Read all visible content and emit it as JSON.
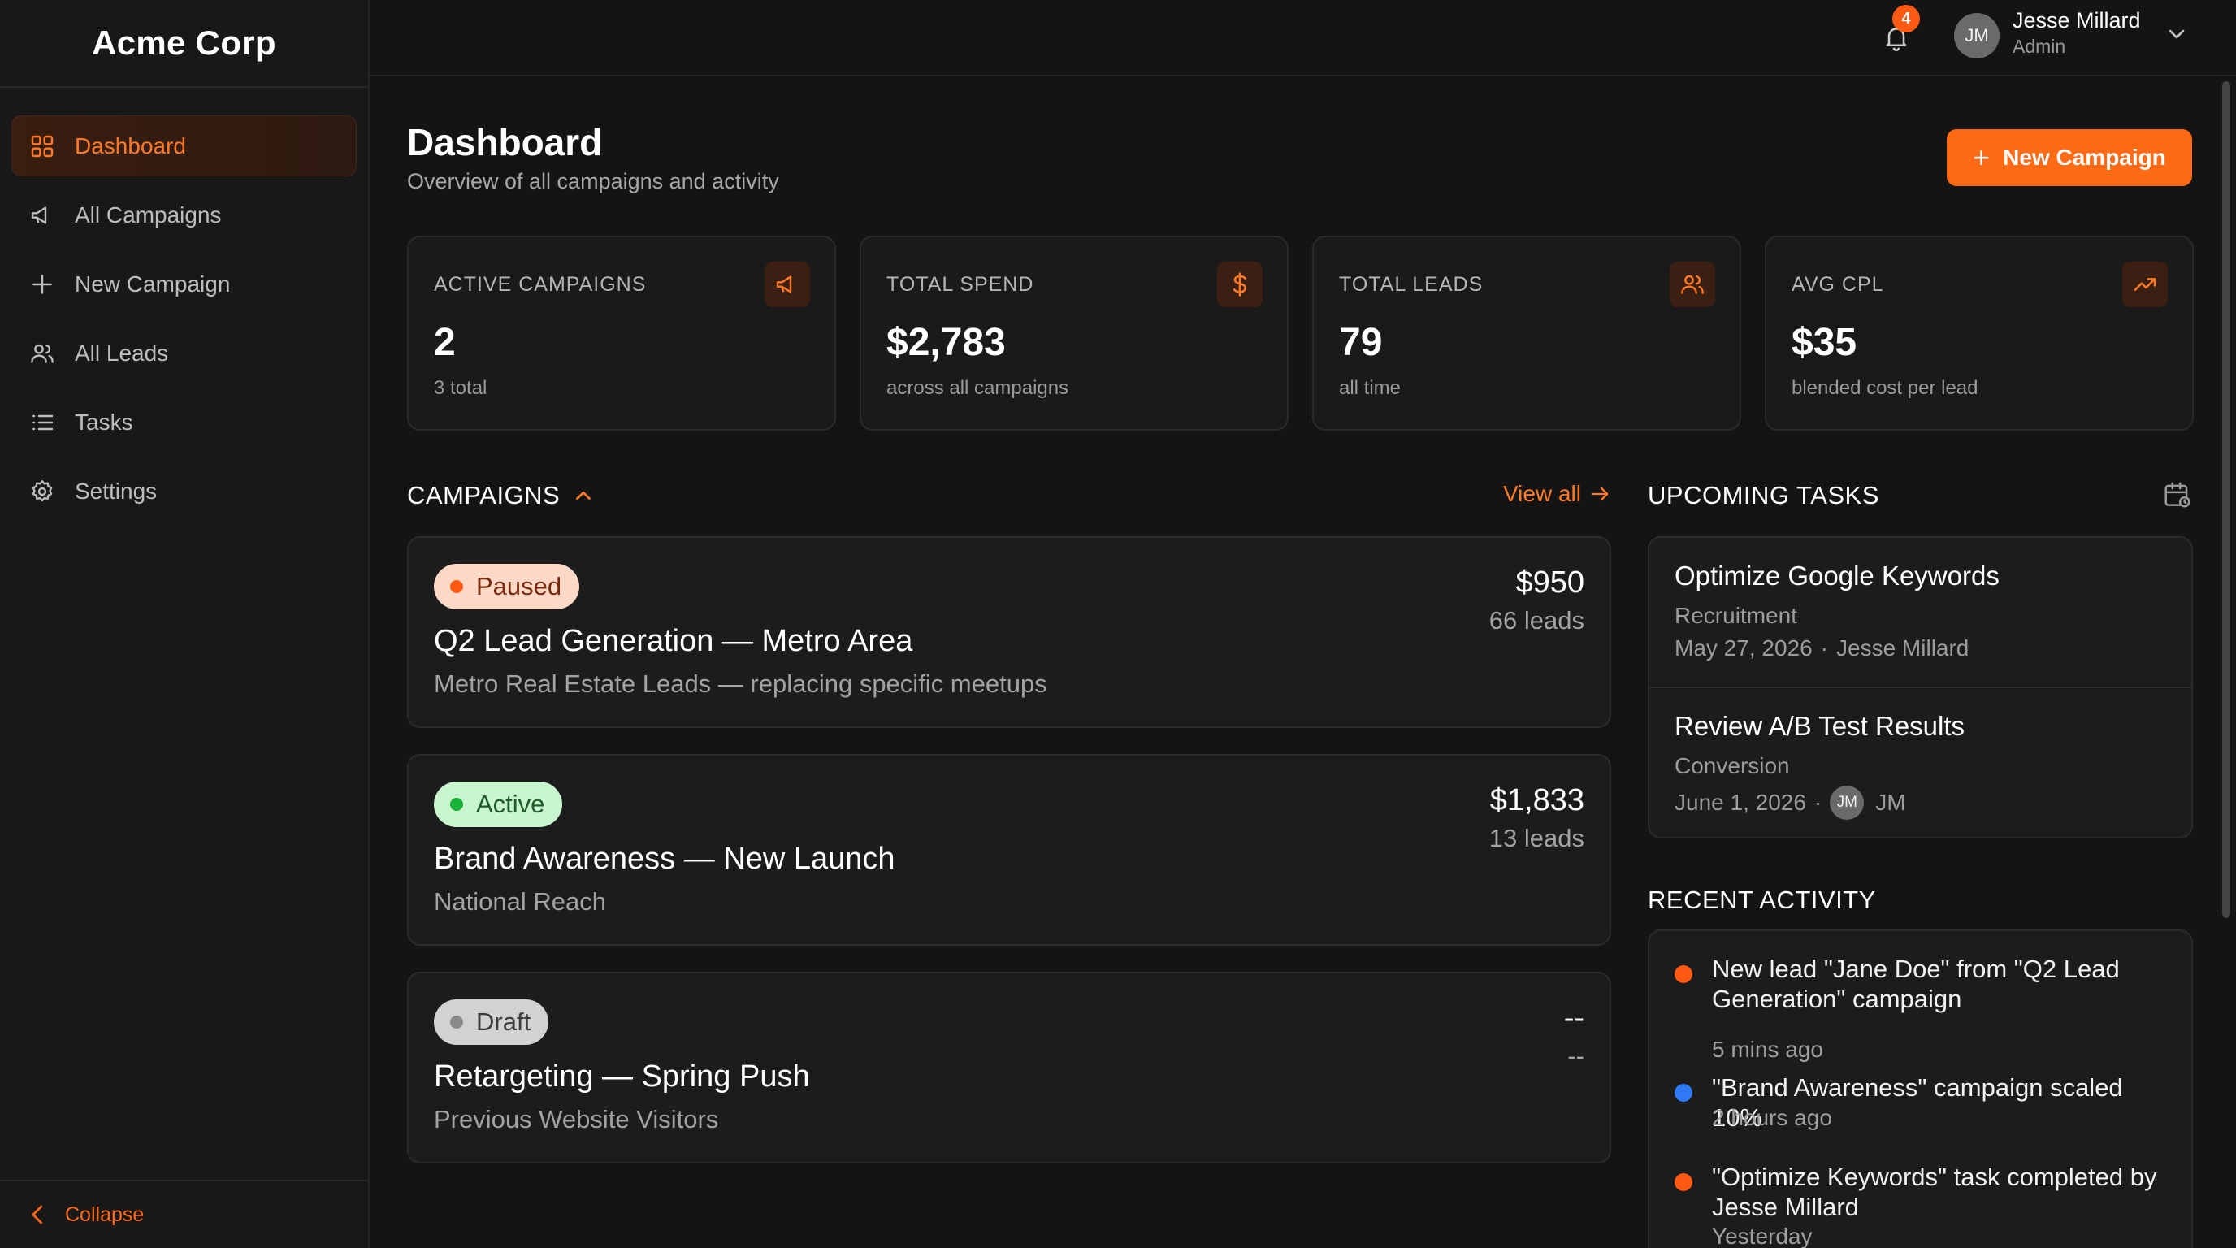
{
  "sidebar": {
    "brand": "Acme Corp",
    "items": [
      {
        "label": "Dashboard"
      },
      {
        "label": "All Campaigns"
      },
      {
        "label": "New Campaign"
      },
      {
        "label": "All Leads"
      },
      {
        "label": "Tasks"
      },
      {
        "label": "Settings"
      }
    ],
    "collapse_label": "Collapse"
  },
  "topbar": {
    "notification_count": "4",
    "user_initials": "JM",
    "user_name": "Jesse Millard",
    "user_role": "Admin"
  },
  "header": {
    "title": "Dashboard",
    "subtitle": "Overview of all campaigns and activity",
    "new_campaign_label": "New Campaign"
  },
  "stats": [
    {
      "label": "ACTIVE CAMPAIGNS",
      "value": "2",
      "sub": "3 total",
      "icon": "megaphone-icon"
    },
    {
      "label": "TOTAL SPEND",
      "value": "$2,783",
      "sub": "across all campaigns",
      "icon": "dollar-icon"
    },
    {
      "label": "TOTAL LEADS",
      "value": "79",
      "sub": "all time",
      "icon": "users-icon"
    },
    {
      "label": "AVG CPL",
      "value": "$35",
      "sub": "blended cost per lead",
      "icon": "trend-up-icon"
    }
  ],
  "campaigns": {
    "heading": "CAMPAIGNS",
    "view_all": "View all",
    "items": [
      {
        "status": "Paused",
        "title": "Q2 Lead Generation — Metro Area",
        "desc": "Metro Real Estate Leads — replacing specific meetups",
        "amount": "$950",
        "leads": "66 leads"
      },
      {
        "status": "Active",
        "title": "Brand Awareness — New Launch",
        "desc": "National Reach",
        "amount": "$1,833",
        "leads": "13 leads"
      },
      {
        "status": "Draft",
        "title": "Retargeting — Spring Push",
        "desc": "Previous Website Visitors",
        "amount": "--",
        "leads": "--"
      }
    ]
  },
  "tasks": {
    "heading": "UPCOMING TASKS",
    "items": [
      {
        "title": "Optimize Google Keywords",
        "category": "Recruitment",
        "date": "May 27, 2026",
        "sep": "·",
        "assignee": "Jesse Millard"
      },
      {
        "title": "Review A/B Test Results",
        "category": "Conversion",
        "date": "June 1, 2026",
        "sep": "·",
        "avatar": "JM",
        "assignee": "JM"
      }
    ]
  },
  "activity": {
    "heading": "RECENT ACTIVITY",
    "items": [
      {
        "text": "New lead \"Jane Doe\" from \"Q2 Lead Generation\" campaign",
        "time": "5 mins ago",
        "color": "#ff5a14"
      },
      {
        "text": "\"Brand Awareness\" campaign scaled 10%",
        "time": "2 hours ago",
        "color": "#2f7bf5"
      },
      {
        "text": "\"Optimize Keywords\" task completed by Jesse Millard",
        "time": "Yesterday",
        "color": "#ff5a14"
      }
    ]
  },
  "colors": {
    "accent": "#ff6a14",
    "background": "#141414",
    "card": "#1c1c1c"
  }
}
